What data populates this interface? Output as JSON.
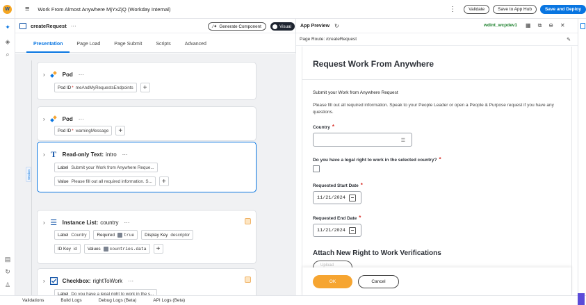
{
  "app": {
    "logo_letter": "W",
    "title": "Work From Almost Anywhere MjYxZjQ (Workday Internal)"
  },
  "topbar": {
    "kebab": "⋮",
    "validate": "Validate",
    "save_hub": "Save to App Hub",
    "save_deploy": "Save and Deploy"
  },
  "rail": {
    "icons": [
      "sparkle-icon",
      "layers-icon",
      "search-icon",
      "notes-icon",
      "history-icon",
      "user-icon"
    ]
  },
  "editor": {
    "file_name": "createRequest",
    "more": "···",
    "generate_label": "Generate Component",
    "visual_label": "Visual",
    "tabs": [
      "Presentation",
      "Page Load",
      "Page Submit",
      "Scripts",
      "Advanced"
    ],
    "active_tab": "Presentation",
    "section_tag": "Section",
    "cards": [
      {
        "type": "Pod",
        "fields": [
          {
            "label": "Pod ID",
            "required": true,
            "value": "meAndMyRequestsEndpoints"
          }
        ]
      },
      {
        "type": "Pod",
        "fields": [
          {
            "label": "Pod ID",
            "required": true,
            "value": "warningMessage"
          }
        ]
      },
      {
        "type": "Read-only Text:",
        "name": "intro",
        "fields": [
          {
            "label": "Label",
            "value": "Submit your Work from Anywhere Reque..."
          },
          {
            "label": "Value",
            "value": "Please fill out all required information. S..."
          }
        ]
      },
      {
        "type": "Instance List:",
        "name": "country",
        "fields": [
          {
            "label": "Label",
            "value": "Country"
          },
          {
            "label": "Required",
            "value": "true"
          },
          {
            "label": "Display Key",
            "value": "descriptor"
          },
          {
            "label": "ID Key",
            "value": "id"
          },
          {
            "label": "Values",
            "value": "countries.data"
          }
        ]
      },
      {
        "type": "Checkbox:",
        "name": "rightToWork",
        "fields": [
          {
            "label": "Label",
            "value": "Do you have a legal right to work in the s..."
          }
        ]
      }
    ]
  },
  "bottombar": {
    "tabs": [
      "Validations",
      "Build Logs",
      "Debug Logs (Beta)",
      "API Logs (Beta)"
    ]
  },
  "preview": {
    "title": "App Preview",
    "tenant": "wdint_wcpdev1",
    "route_label": "Page Route:",
    "route_value": "/createRequest",
    "form": {
      "title": "Request Work From Anywhere",
      "subtitle": "Submit your Work from Anywhere Request",
      "description": "Please fill out all required information. Speak to your People Leader or open a People & Purpose request if you have any questions.",
      "country_label": "Country",
      "legal_label": "Do you have a legal right to work in the selected country?",
      "start_label": "Requested Start Date",
      "start_value": "11/21/2024",
      "end_label": "Requested End Date",
      "end_value": "11/21/2024",
      "attach_heading": "Attach New Right to Work Verifications",
      "upload_label": "Upload",
      "required_mark": "*",
      "ok": "OK",
      "cancel": "Cancel"
    }
  },
  "colors": {
    "accent": "#0875e1",
    "ok_button": "#f6a531",
    "required": "#d8312a",
    "tenant": "#1a7f2a"
  }
}
